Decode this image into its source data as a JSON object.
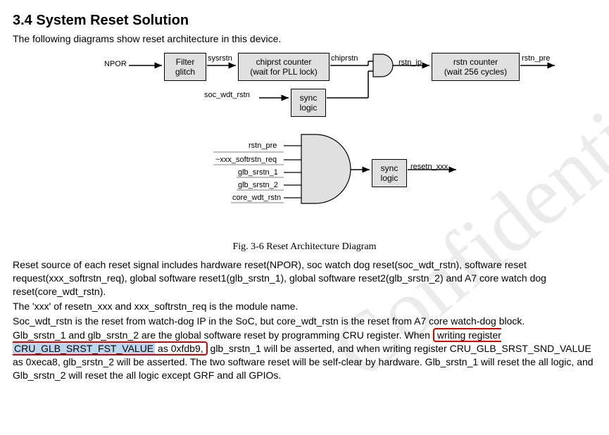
{
  "heading": "3.4 System Reset Solution",
  "intro": "The following diagrams show reset architecture in this device.",
  "watermark": "Confidential",
  "diagram": {
    "labels": {
      "npor": "NPOR",
      "sysrstn": "sysrstn",
      "chiprstn": "chiprstn",
      "rstn_ip": "rstn_ip",
      "rstn_pre_top": "rstn_pre",
      "soc_wdt_rstn": "soc_wdt_rstn",
      "rstn_pre_bot": "rstn_pre",
      "xxx_softrstn_req": "~xxx_softrstn_req",
      "glb_srstn_1": "glb_srstn_1",
      "glb_srstn_2": "glb_srstn_2",
      "core_wdt_rstn": "core_wdt_rstn",
      "resetn_xxx": "resetn_xxx"
    },
    "boxes": {
      "filter_glitch_l1": "Filter",
      "filter_glitch_l2": "glitch",
      "chiprst_counter_l1": "chiprst counter",
      "chiprst_counter_l2": "(wait for PLL lock)",
      "rstn_counter_l1": "rstn counter",
      "rstn_counter_l2": "(wait 256 cycles)",
      "sync_logic_top_l1": "sync",
      "sync_logic_top_l2": "logic",
      "sync_logic_bot_l1": "sync",
      "sync_logic_bot_l2": "logic"
    }
  },
  "caption": "Fig. 3-6 Reset Architecture Diagram",
  "para1": "Reset source of each reset signal includes hardware reset(NPOR), soc watch dog reset(soc_wdt_rstn), software reset request(xxx_softrstn_req), global software reset1(glb_srstn_1), global software reset2(glb_srstn_2) and A7 core watch dog reset(core_wdt_rstn).",
  "para2": "The 'xxx' of resetn_xxx and xxx_softrstn_req is the module name.",
  "para3": "Soc_wdt_rstn is the reset from watch-dog IP in the SoC, but core_wdt_rstn is the reset from A7 core watch-dog block.",
  "para4_pre": "Glb_srstn_1 and glb_srstn_2 are the global software reset by programming CRU register. When ",
  "para4_box_a": "writing register ",
  "para4_box_hl": "CRU_GLB_SRST_FST_VALUE",
  "para4_box_b": " as 0xfdb9,",
  "para4_post": " glb_srstn_1 will be asserted, and when writing register CRU_GLB_SRST_SND_VALUE as 0xeca8, glb_srstn_2 will be asserted. The two software reset will be self-clear by hardware. Glb_srstn_1 will reset the all logic, and Glb_srstn_2 will reset the all logic except GRF and all GPIOs."
}
